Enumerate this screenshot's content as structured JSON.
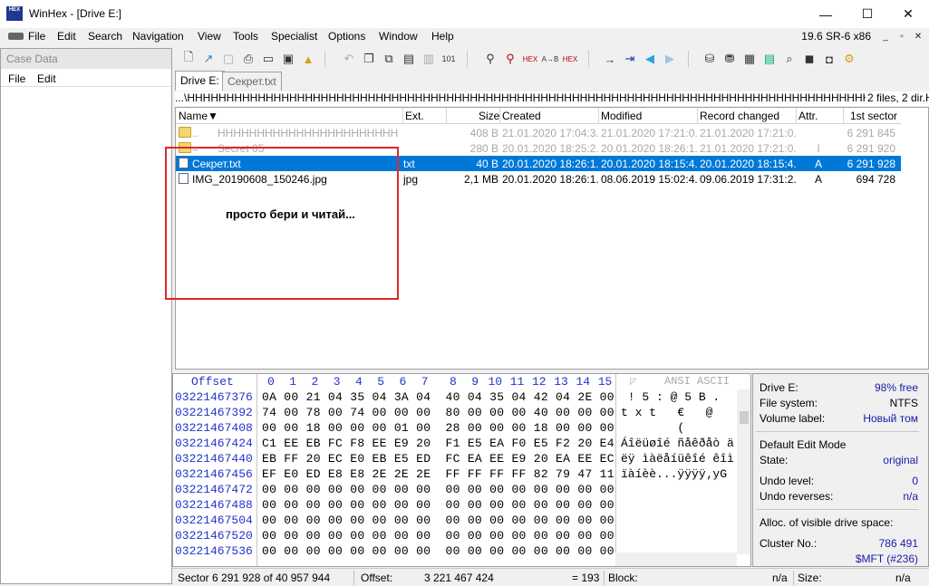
{
  "window": {
    "title": "WinHex - [Drive E:]",
    "app_icon_text": "HEX",
    "version": "19.6 SR-6 x86",
    "buttons": {
      "minimize": "—",
      "maximize": "☐",
      "close": "✕"
    }
  },
  "menu": [
    "File",
    "Edit",
    "Search",
    "Navigation",
    "View",
    "Tools",
    "Specialist",
    "Options",
    "Window",
    "Help"
  ],
  "case_pane": {
    "title": "Case Data",
    "menu": [
      "File",
      "Edit"
    ]
  },
  "tabs": [
    "Drive E:",
    "Секрет.txt"
  ],
  "path": "...\\HHHHHHHHHHHHHHHHHHHHHHHHHHHHHHHHHHHHHHHHHHHHHHHHHHHHHHHHHHHHHHHHHHHHHHHHHHHHHHHHHHHHHHHHHHHHHHHHHHHHHHHHHHHHHHHHHH",
  "file_count": "2 files, 2 dir.",
  "columns": [
    "Name",
    "Ext.",
    "Size",
    "Created",
    "Modified",
    "Record changed",
    "Attr.",
    "1st sector"
  ],
  "sort_indicator": "▼",
  "rows": [
    {
      "icon": "folder",
      "name": "..",
      "name2": "HHHHHHHHHHHHHHHHHHHHHHHHH",
      "ext": "",
      "size": "408 B",
      "created": "21.01.2020  17:04:3...",
      "modified": "21.01.2020  17:21:0...",
      "record": "21.01.2020  17:21:0...",
      "attr": "",
      "sector": "6 291 845",
      "style": "dim"
    },
    {
      "icon": "folder",
      "name": "=",
      "name2": "Secret 05",
      "ext": "",
      "size": "280 B",
      "created": "20.01.2020  18:25:2...",
      "modified": "20.01.2020  18:26:1...",
      "record": "21.01.2020  17:21:0...",
      "attr": "I",
      "sector": "6 291 920",
      "style": "dim"
    },
    {
      "icon": "file",
      "name": "Секрет.txt",
      "name2": "",
      "ext": "txt",
      "size": "40 B",
      "created": "20.01.2020  18:26:1...",
      "modified": "20.01.2020  18:15:4...",
      "record": "20.01.2020  18:15:4...",
      "attr": "A",
      "sector": "6 291 928",
      "style": "sel"
    },
    {
      "icon": "file",
      "name": "IMG_20190608_150246.jpg",
      "name2": "",
      "ext": "jpg",
      "size": "2,1 MB",
      "created": "20.01.2020  18:26:1...",
      "modified": "08.06.2019  15:02:4...",
      "record": "09.06.2019  17:31:2...",
      "attr": "A",
      "sector": "694 728",
      "style": "normal"
    }
  ],
  "annotation": "просто бери и читай...",
  "hex": {
    "offset_label": "Offset",
    "col_headers": [
      "0",
      "1",
      "2",
      "3",
      "4",
      "5",
      "6",
      "7",
      "8",
      "9",
      "10",
      "11",
      "12",
      "13",
      "14",
      "15"
    ],
    "ascii_label": "ANSI ASCII",
    "rows": [
      {
        "offset": "03221467376",
        "bytes": "0A 00 21 04 35 04 3A 04  40 04 35 04 42 04 2E 00",
        "ascii": " ! 5 : @ 5 B . "
      },
      {
        "offset": "03221467392",
        "bytes": "74 00 78 00 74 00 00 00  80 00 00 00 40 00 00 00",
        "ascii": "t x t   €   @  "
      },
      {
        "offset": "03221467408",
        "bytes": "00 00 18 00 00 00 01 00  28 00 00 00 18 00 00 00",
        "ascii": "        (      "
      },
      {
        "offset": "03221467424",
        "bytes": "C1 EE EB FC F8 EE E9 20  F1 E5 EA F0 E5 F2 20 E4",
        "ascii": "Áîëüøîé ñåêðåò ä"
      },
      {
        "offset": "03221467440",
        "bytes": "EB FF 20 EC E0 EB E5 ED  FC EA EE E9 20 EA EE EC",
        "ascii": "ëÿ ìàëåíüêîé êîì"
      },
      {
        "offset": "03221467456",
        "bytes": "EF E0 ED E8 E8 2E 2E 2E  FF FF FF FF 82 79 47 11",
        "ascii": "ïàíèè...ÿÿÿÿ‚yG "
      },
      {
        "offset": "03221467472",
        "bytes": "00 00 00 00 00 00 00 00  00 00 00 00 00 00 00 00",
        "ascii": ""
      },
      {
        "offset": "03221467488",
        "bytes": "00 00 00 00 00 00 00 00  00 00 00 00 00 00 00 00",
        "ascii": ""
      },
      {
        "offset": "03221467504",
        "bytes": "00 00 00 00 00 00 00 00  00 00 00 00 00 00 00 00",
        "ascii": ""
      },
      {
        "offset": "03221467520",
        "bytes": "00 00 00 00 00 00 00 00  00 00 00 00 00 00 00 00",
        "ascii": ""
      },
      {
        "offset": "03221467536",
        "bytes": "00 00 00 00 00 00 00 00  00 00 00 00 00 00 00 00",
        "ascii": ""
      }
    ]
  },
  "info": {
    "drive": "Drive E:",
    "drive_free": "98% free",
    "fs_label": "File system:",
    "fs_value": "NTFS",
    "vol_label": "Volume label:",
    "vol_value": "Новый том",
    "mode_title": "Default Edit Mode",
    "state_label": "State:",
    "state_value": "original",
    "undo_label": "Undo level:",
    "undo_value": "0",
    "undo_rev_label": "Undo reverses:",
    "undo_rev_value": "n/a",
    "alloc_label": "Alloc. of visible drive space:",
    "cluster_label": "Cluster No.:",
    "cluster_value": "786 491",
    "mft_value": "$MFT (#236)"
  },
  "status": {
    "sector": "Sector 6 291 928 of 40 957 944",
    "offset_label": "Offset:",
    "offset_value": "3 221 467 424",
    "eq_value": "= 193",
    "block_label": "Block:",
    "block_value": "n/a",
    "size_label": "Size:",
    "size_value": "n/a"
  }
}
